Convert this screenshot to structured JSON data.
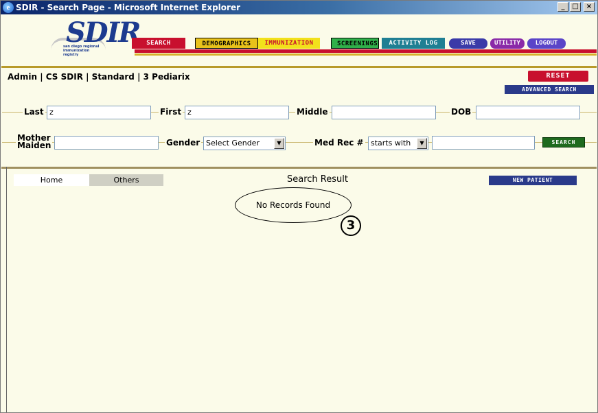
{
  "window": {
    "title": "SDIR - Search Page - Microsoft Internet Explorer",
    "controls": [
      "_",
      "□",
      "×"
    ]
  },
  "logo": {
    "letters": "SDIR",
    "tagline": "san diego regional immunization registry"
  },
  "nav": {
    "search": "SEARCH",
    "demographics": "DEMOGRAPHICS",
    "immunization": "IMMUNIZATION",
    "screenings": "SCREENINGS",
    "activity_log": "ACTIVITY LOG",
    "save": "SAVE",
    "utility": "UTILITY",
    "logout": "LOGOUT"
  },
  "context": "Admin | CS SDIR | Standard | 3 Pediarix",
  "buttons": {
    "reset": "RESET",
    "advanced_search": "ADVANCED SEARCH",
    "search": "SEARCH",
    "new_patient": "NEW PATIENT"
  },
  "form": {
    "last_label": "Last",
    "last_value": "z",
    "first_label": "First",
    "first_value": "z",
    "middle_label": "Middle",
    "middle_value": "",
    "dob_label": "DOB",
    "dob_value": "",
    "mother_label_1": "Mother",
    "mother_label_2": "Maiden",
    "mother_value": "",
    "gender_label": "Gender",
    "gender_selected": "Select Gender",
    "medrec_label": "Med Rec #",
    "medrec_mode": "starts with",
    "medrec_value": ""
  },
  "results": {
    "tab_home": "Home",
    "tab_others": "Others",
    "title": "Search Result",
    "message": "No Records Found",
    "callout": "3"
  },
  "colors": {
    "background": "#fbfbe9",
    "brand_red": "#c8102e",
    "brand_navy": "#2a3a8a",
    "search_green": "#1e6a1e"
  }
}
